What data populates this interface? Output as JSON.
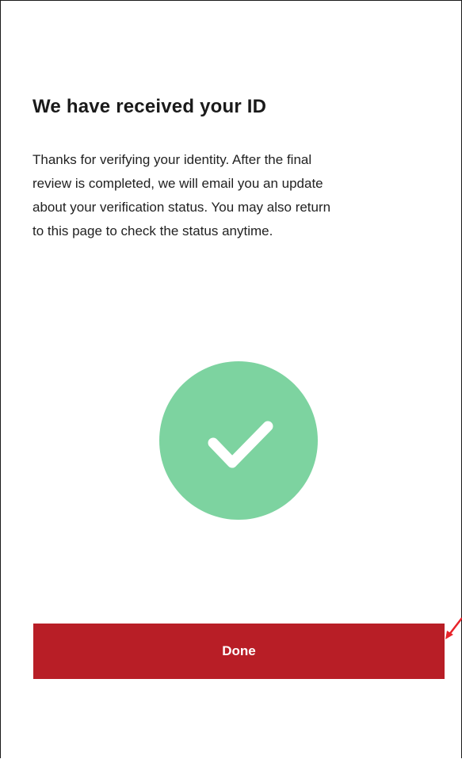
{
  "content": {
    "title": "We have received your ID",
    "body_lines": [
      "Thanks for verifying your identity. After the final",
      "review is completed, we will email you an update",
      "about your verification status. You may also return",
      "to this page to check the status anytime."
    ]
  },
  "status_icon": {
    "name": "checkmark-icon",
    "circle_color": "#7dd3a0",
    "mark_color": "#ffffff"
  },
  "actions": {
    "done_label": "Done",
    "button_color": "#b81e26"
  },
  "annotation": {
    "arrow_color": "#e8232a"
  }
}
